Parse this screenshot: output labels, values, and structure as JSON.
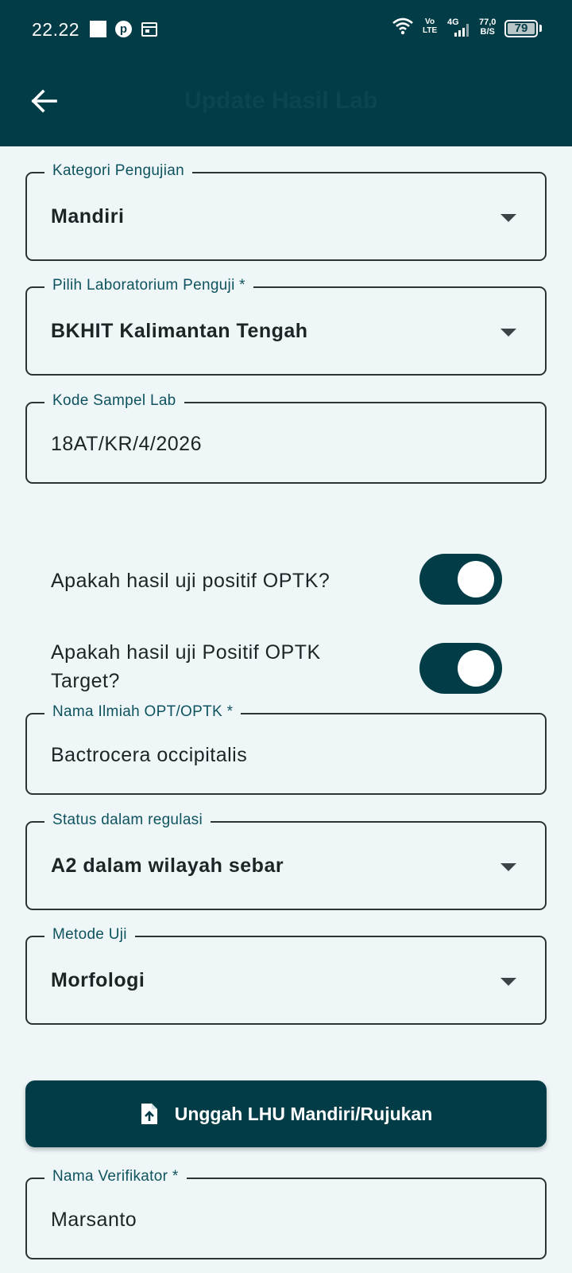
{
  "status_bar": {
    "time": "22.22",
    "volte_top": "Vo",
    "volte_bottom": "LTE",
    "network": "4G",
    "speed_value": "77,0",
    "speed_unit": "B/S",
    "battery": "79"
  },
  "app_bar": {
    "title": "Update Hasil Lab"
  },
  "form": {
    "kategori": {
      "label": "Kategori Pengujian",
      "value": "Mandiri"
    },
    "laboratorium": {
      "label": "Pilih Laboratorium Penguji *",
      "value": "BKHIT Kalimantan Tengah"
    },
    "kode_sampel": {
      "label": "Kode Sampel Lab",
      "value": "18AT/KR/4/2026"
    },
    "toggle_positif": {
      "label": "Apakah hasil uji positif OPTK?",
      "on": true
    },
    "toggle_target": {
      "label": "Apakah hasil uji Positif OPTK Target?",
      "on": true
    },
    "nama_ilmiah": {
      "label": "Nama Ilmiah OPT/OPTK *",
      "value": "Bactrocera occipitalis"
    },
    "status_regulasi": {
      "label": "Status dalam regulasi",
      "value": "A2 dalam wilayah sebar"
    },
    "metode_uji": {
      "label": "Metode Uji",
      "value": "Morfologi"
    },
    "upload_button": {
      "label": "Unggah LHU Mandiri/Rujukan"
    },
    "nama_verifikator": {
      "label": "Nama Verifikator *",
      "value": "Marsanto"
    }
  },
  "colors": {
    "primary": "#023C46",
    "background": "#EEF6F8"
  }
}
